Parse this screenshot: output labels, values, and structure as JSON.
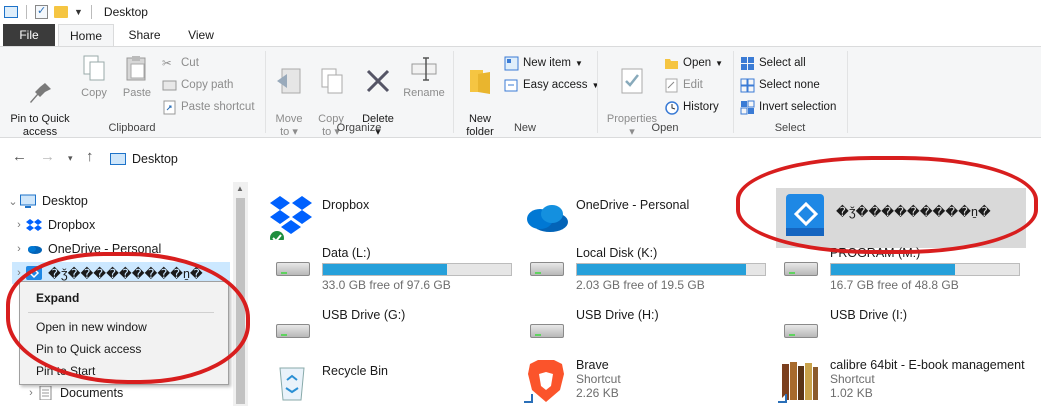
{
  "window": {
    "title": "Desktop"
  },
  "tabs": [
    "File",
    "Home",
    "Share",
    "View"
  ],
  "ribbon": {
    "clipboard": {
      "label": "Clipboard",
      "pin": "Pin to Quick\naccess",
      "copy": "Copy",
      "paste": "Paste",
      "cut": "Cut",
      "copy_path": "Copy path",
      "paste_shortcut": "Paste shortcut"
    },
    "organize": {
      "label": "Organize",
      "move_to": "Move\nto ▾",
      "copy_to": "Copy\nto ▾",
      "delete": "Delete\n▾",
      "rename": "Rename"
    },
    "new": {
      "label": "New",
      "new_folder": "New\nfolder",
      "new_item": "New item",
      "easy_access": "Easy access"
    },
    "open": {
      "label": "Open",
      "properties": "Properties\n▾",
      "open": "Open",
      "edit": "Edit",
      "history": "History"
    },
    "select": {
      "label": "Select",
      "select_all": "Select all",
      "select_none": "Select none",
      "invert": "Invert selection"
    }
  },
  "address": {
    "path": "Desktop"
  },
  "nav": {
    "items": [
      {
        "label": "Desktop"
      },
      {
        "label": "Dropbox"
      },
      {
        "label": "OneDrive - Personal"
      },
      {
        "label": "�ǯ���������ṉ�"
      },
      {
        "label": "Documents"
      }
    ]
  },
  "context_menu": {
    "items": [
      "Expand",
      "Open in new window",
      "Pin to Quick access",
      "Pin to Start"
    ]
  },
  "content": {
    "items": [
      {
        "name": "Dropbox"
      },
      {
        "name": "OneDrive - Personal"
      },
      {
        "name": "�ǯ���������ṉ�"
      },
      {
        "name": "Data (L:)",
        "free": "33.0 GB free of 97.6 GB",
        "used_fraction": 0.66
      },
      {
        "name": "Local Disk (K:)",
        "free": "2.03 GB free of 19.5 GB",
        "used_fraction": 0.9
      },
      {
        "name": "PROGRAM (M:)",
        "free": "16.7 GB free of 48.8 GB",
        "used_fraction": 0.66
      },
      {
        "name": "USB Drive (G:)"
      },
      {
        "name": "USB Drive (H:)"
      },
      {
        "name": "USB Drive (I:)"
      },
      {
        "name": "Recycle Bin"
      },
      {
        "name": "Brave",
        "type": "Shortcut",
        "size": "2.26 KB"
      },
      {
        "name": "calibre 64bit - E-book management",
        "type": "Shortcut",
        "size": "1.02 KB"
      }
    ]
  },
  "colors": {
    "accent": "#26a0da",
    "selection": "#cce8ff",
    "annotation": "#d81e1e"
  }
}
